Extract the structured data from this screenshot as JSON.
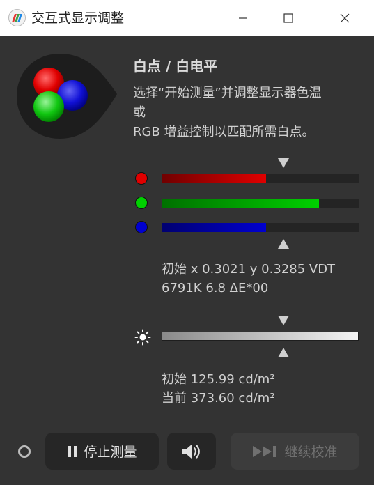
{
  "window": {
    "title": "交互式显示调整"
  },
  "titlebar_buttons": [
    "minimize-icon",
    "maximize-icon",
    "close-icon"
  ],
  "section": {
    "heading": "白点 / 白电平",
    "description_lines": [
      "选择“开始测量”并调整显示器色温",
      "或",
      "RGB 增益控制以匹配所需白点。"
    ]
  },
  "rgb": {
    "channels": [
      {
        "name": "R",
        "color": "#e00000",
        "level": 0.53
      },
      {
        "name": "G",
        "color": "#00d000",
        "level": 0.8
      },
      {
        "name": "B",
        "color": "#0000d0",
        "level": 0.53
      }
    ],
    "readout_lines": [
      "初始 x 0.3021 y 0.3285 VDT",
      "6791K 6.8 ΔE*00"
    ]
  },
  "luminance": {
    "readout_lines": [
      "初始 125.99 cd/m²",
      "当前 373.60 cd/m²"
    ]
  },
  "buttons": {
    "stop": "停止测量",
    "continue": "继续校准"
  }
}
